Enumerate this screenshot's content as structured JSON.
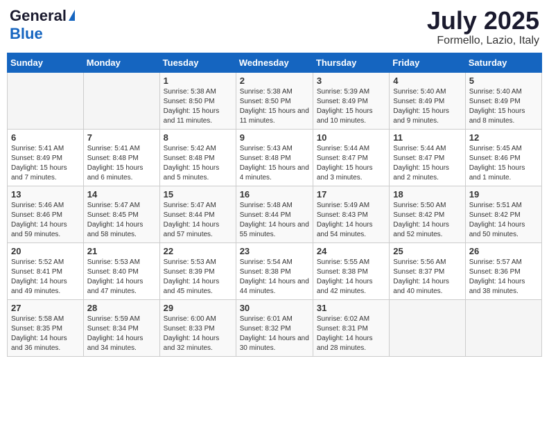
{
  "header": {
    "logo_general": "General",
    "logo_blue": "Blue",
    "month_year": "July 2025",
    "location": "Formello, Lazio, Italy"
  },
  "weekdays": [
    "Sunday",
    "Monday",
    "Tuesday",
    "Wednesday",
    "Thursday",
    "Friday",
    "Saturday"
  ],
  "weeks": [
    [
      {
        "day": "",
        "info": ""
      },
      {
        "day": "",
        "info": ""
      },
      {
        "day": "1",
        "info": "Sunrise: 5:38 AM\nSunset: 8:50 PM\nDaylight: 15 hours and 11 minutes."
      },
      {
        "day": "2",
        "info": "Sunrise: 5:38 AM\nSunset: 8:50 PM\nDaylight: 15 hours and 11 minutes."
      },
      {
        "day": "3",
        "info": "Sunrise: 5:39 AM\nSunset: 8:49 PM\nDaylight: 15 hours and 10 minutes."
      },
      {
        "day": "4",
        "info": "Sunrise: 5:40 AM\nSunset: 8:49 PM\nDaylight: 15 hours and 9 minutes."
      },
      {
        "day": "5",
        "info": "Sunrise: 5:40 AM\nSunset: 8:49 PM\nDaylight: 15 hours and 8 minutes."
      }
    ],
    [
      {
        "day": "6",
        "info": "Sunrise: 5:41 AM\nSunset: 8:49 PM\nDaylight: 15 hours and 7 minutes."
      },
      {
        "day": "7",
        "info": "Sunrise: 5:41 AM\nSunset: 8:48 PM\nDaylight: 15 hours and 6 minutes."
      },
      {
        "day": "8",
        "info": "Sunrise: 5:42 AM\nSunset: 8:48 PM\nDaylight: 15 hours and 5 minutes."
      },
      {
        "day": "9",
        "info": "Sunrise: 5:43 AM\nSunset: 8:48 PM\nDaylight: 15 hours and 4 minutes."
      },
      {
        "day": "10",
        "info": "Sunrise: 5:44 AM\nSunset: 8:47 PM\nDaylight: 15 hours and 3 minutes."
      },
      {
        "day": "11",
        "info": "Sunrise: 5:44 AM\nSunset: 8:47 PM\nDaylight: 15 hours and 2 minutes."
      },
      {
        "day": "12",
        "info": "Sunrise: 5:45 AM\nSunset: 8:46 PM\nDaylight: 15 hours and 1 minute."
      }
    ],
    [
      {
        "day": "13",
        "info": "Sunrise: 5:46 AM\nSunset: 8:46 PM\nDaylight: 14 hours and 59 minutes."
      },
      {
        "day": "14",
        "info": "Sunrise: 5:47 AM\nSunset: 8:45 PM\nDaylight: 14 hours and 58 minutes."
      },
      {
        "day": "15",
        "info": "Sunrise: 5:47 AM\nSunset: 8:44 PM\nDaylight: 14 hours and 57 minutes."
      },
      {
        "day": "16",
        "info": "Sunrise: 5:48 AM\nSunset: 8:44 PM\nDaylight: 14 hours and 55 minutes."
      },
      {
        "day": "17",
        "info": "Sunrise: 5:49 AM\nSunset: 8:43 PM\nDaylight: 14 hours and 54 minutes."
      },
      {
        "day": "18",
        "info": "Sunrise: 5:50 AM\nSunset: 8:42 PM\nDaylight: 14 hours and 52 minutes."
      },
      {
        "day": "19",
        "info": "Sunrise: 5:51 AM\nSunset: 8:42 PM\nDaylight: 14 hours and 50 minutes."
      }
    ],
    [
      {
        "day": "20",
        "info": "Sunrise: 5:52 AM\nSunset: 8:41 PM\nDaylight: 14 hours and 49 minutes."
      },
      {
        "day": "21",
        "info": "Sunrise: 5:53 AM\nSunset: 8:40 PM\nDaylight: 14 hours and 47 minutes."
      },
      {
        "day": "22",
        "info": "Sunrise: 5:53 AM\nSunset: 8:39 PM\nDaylight: 14 hours and 45 minutes."
      },
      {
        "day": "23",
        "info": "Sunrise: 5:54 AM\nSunset: 8:38 PM\nDaylight: 14 hours and 44 minutes."
      },
      {
        "day": "24",
        "info": "Sunrise: 5:55 AM\nSunset: 8:38 PM\nDaylight: 14 hours and 42 minutes."
      },
      {
        "day": "25",
        "info": "Sunrise: 5:56 AM\nSunset: 8:37 PM\nDaylight: 14 hours and 40 minutes."
      },
      {
        "day": "26",
        "info": "Sunrise: 5:57 AM\nSunset: 8:36 PM\nDaylight: 14 hours and 38 minutes."
      }
    ],
    [
      {
        "day": "27",
        "info": "Sunrise: 5:58 AM\nSunset: 8:35 PM\nDaylight: 14 hours and 36 minutes."
      },
      {
        "day": "28",
        "info": "Sunrise: 5:59 AM\nSunset: 8:34 PM\nDaylight: 14 hours and 34 minutes."
      },
      {
        "day": "29",
        "info": "Sunrise: 6:00 AM\nSunset: 8:33 PM\nDaylight: 14 hours and 32 minutes."
      },
      {
        "day": "30",
        "info": "Sunrise: 6:01 AM\nSunset: 8:32 PM\nDaylight: 14 hours and 30 minutes."
      },
      {
        "day": "31",
        "info": "Sunrise: 6:02 AM\nSunset: 8:31 PM\nDaylight: 14 hours and 28 minutes."
      },
      {
        "day": "",
        "info": ""
      },
      {
        "day": "",
        "info": ""
      }
    ]
  ]
}
